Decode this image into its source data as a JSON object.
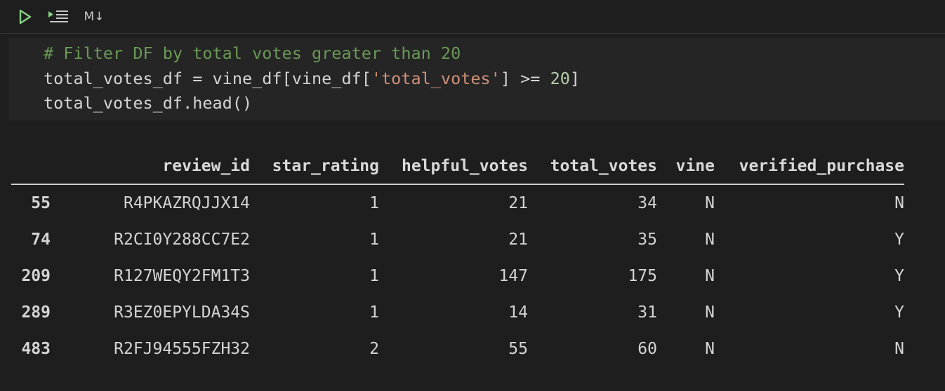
{
  "toolbar": {
    "run_icon": "play-icon",
    "run_below_icon": "run-below-icon",
    "markdown_label": "M↓",
    "accent_color": "#89d185"
  },
  "code": {
    "line1": "# Filter DF by total votes greater than 20",
    "line2_a": "total_votes_df = vine_df[vine_df[",
    "line2_str": "'total_votes'",
    "line2_b": "] >= ",
    "line2_num": "20",
    "line2_c": "]",
    "line3": "total_votes_df.head()"
  },
  "table": {
    "columns": [
      "",
      "review_id",
      "star_rating",
      "helpful_votes",
      "total_votes",
      "vine",
      "verified_purchase"
    ],
    "rows": [
      [
        "55",
        "R4PKAZRQJJX14",
        "1",
        "21",
        "34",
        "N",
        "N"
      ],
      [
        "74",
        "R2CI0Y288CC7E2",
        "1",
        "21",
        "35",
        "N",
        "Y"
      ],
      [
        "209",
        "R127WEQY2FM1T3",
        "1",
        "147",
        "175",
        "N",
        "Y"
      ],
      [
        "289",
        "R3EZ0EPYLDA34S",
        "1",
        "14",
        "31",
        "N",
        "Y"
      ],
      [
        "483",
        "R2FJ94555FZH32",
        "2",
        "55",
        "60",
        "N",
        "N"
      ]
    ]
  }
}
